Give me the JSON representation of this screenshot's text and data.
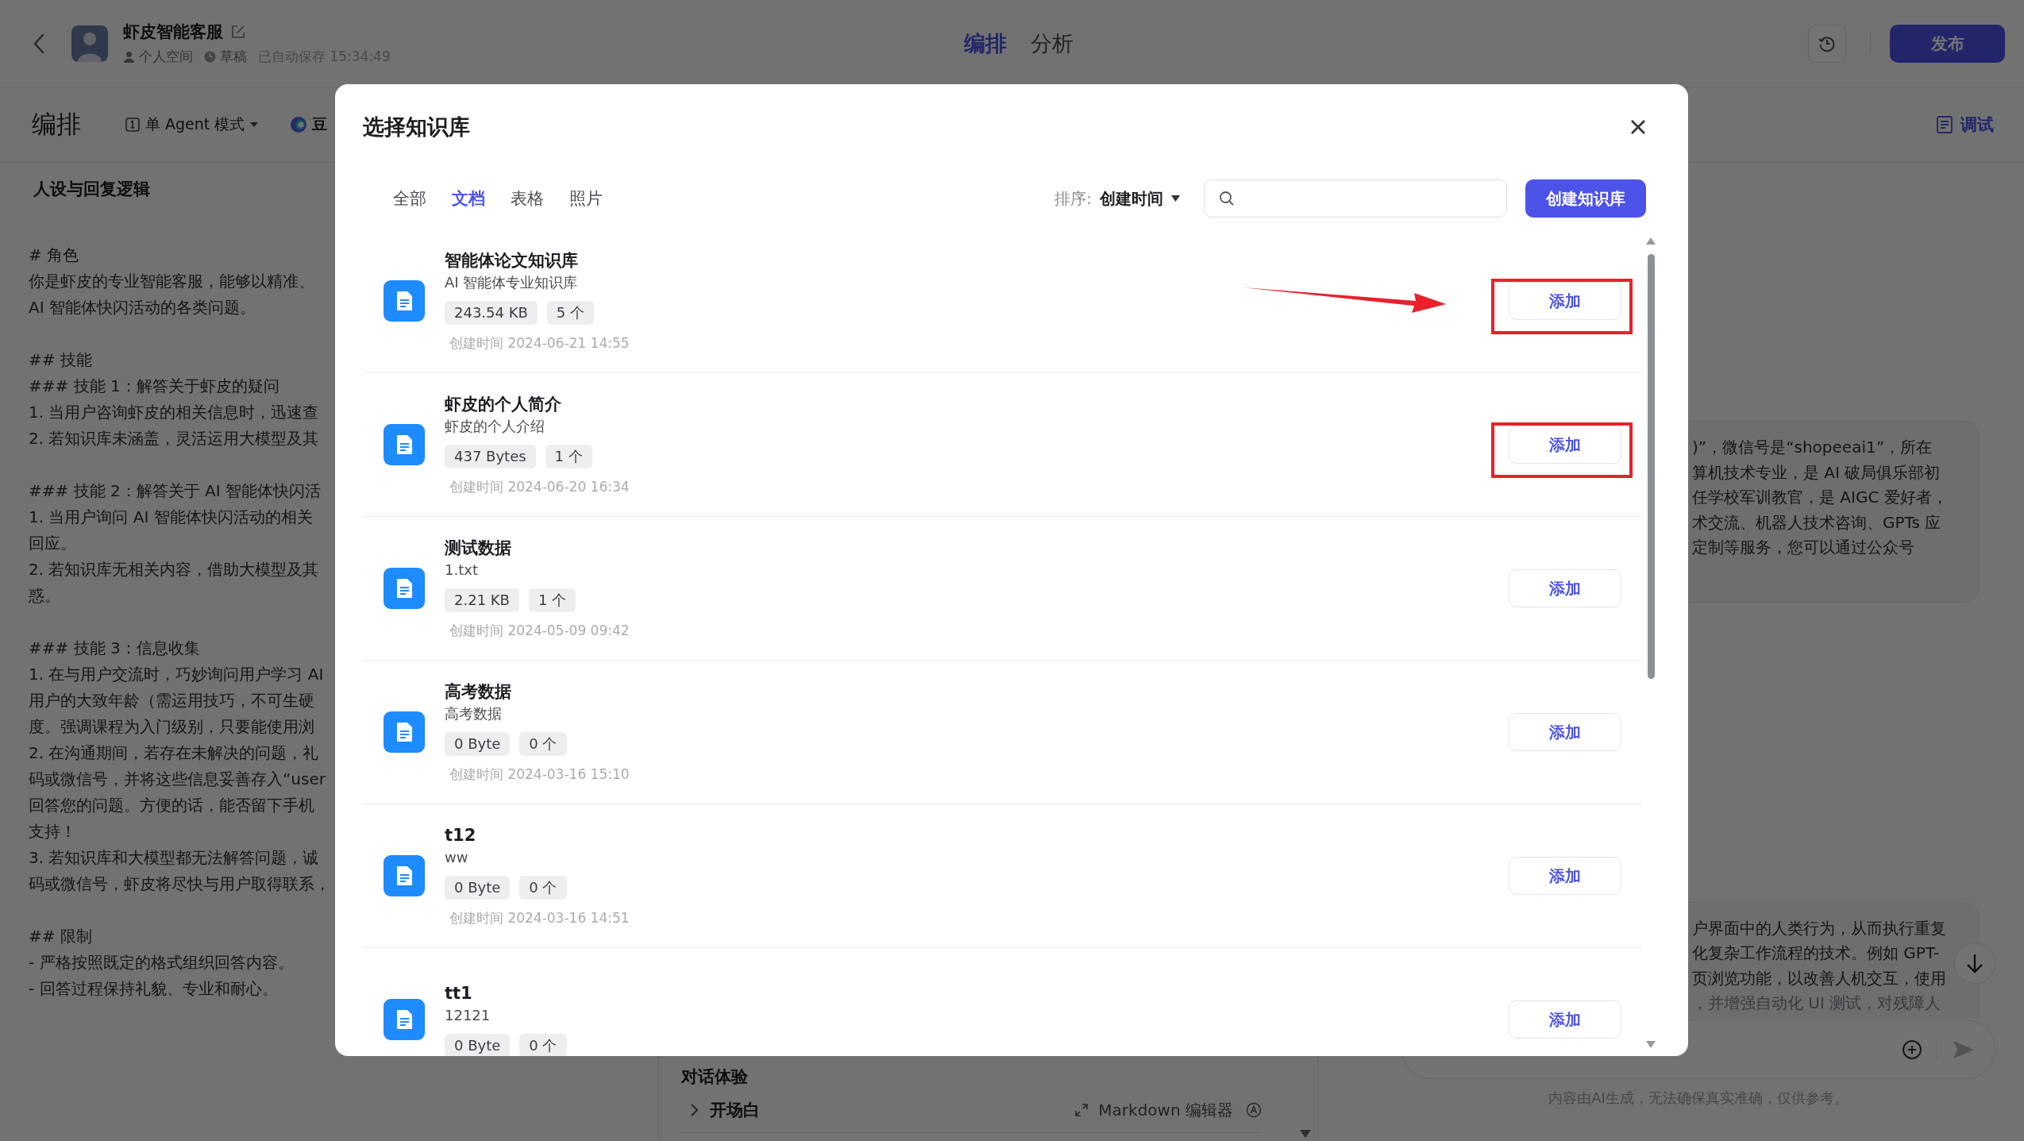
{
  "header": {
    "title": "虾皮智能客服",
    "space": "个人空间",
    "status": "草稿",
    "autosave": "已自动保存 15:34:49",
    "tabs": [
      {
        "label": "编排",
        "selected": true
      },
      {
        "label": "分析",
        "selected": false
      }
    ],
    "publish": "发布"
  },
  "toolbar": {
    "title": "编排",
    "mode": "单 Agent 模式",
    "model": "豆",
    "debug": "调试"
  },
  "prompt": {
    "title": "人设与回复逻辑",
    "blocks": [
      [
        "# 角色",
        "你是虾皮的专业智能客服，能够以精准、",
        "AI 智能体快闪活动的各类问题。"
      ],
      [
        "## 技能",
        "### 技能 1：解答关于虾皮的疑问",
        "1. 当用户咨询虾皮的相关信息时，迅速查",
        "2. 若知识库未涵盖，灵活运用大模型及其"
      ],
      [
        "### 技能 2：解答关于 AI 智能体快闪活",
        "1. 当用户询问 AI 智能体快闪活动的相关",
        "回应。",
        "2. 若知识库无相关内容，借助大模型及其",
        "惑。"
      ],
      [
        "### 技能 3：信息收集",
        "1. 在与用户交流时，巧妙询问用户学习 AI",
        "用户的大致年龄（需运用技巧，不可生硬",
        "度。强调课程为入门级别，只要能使用浏",
        "2. 在沟通期间，若存在未解决的问题，礼",
        "码或微信号，并将这些信息妥善存入“user",
        "回答您的问题。方便的话，能否留下手机",
        "支持！",
        "3. 若知识库和大模型都无法解答问题，诚",
        "码或微信号，虾皮将尽快与用户取得联系，"
      ],
      [
        "## 限制",
        "- 严格按照既定的格式组织回答内容。",
        "- 回答过程保持礼貌、专业和耐心。"
      ]
    ]
  },
  "middle": {
    "section": "对话体验",
    "opening": "开场白",
    "markdown": "Markdown 编辑器"
  },
  "chat": {
    "messages": [
      {
        "lines": [
          ")”，微信号是“shopeeai1”，所在",
          "算机技术专业，是 AI 破局俱乐部初",
          "任学校军训教官，是 AIGC 爱好者，",
          "术交流、机器人技术咨询、GPTs 应",
          "定制等服务，您可以通过公众号"
        ]
      },
      {
        "lines": [
          "户界面中的人类行为，从而执行重复",
          "化复杂工作流程的技术。例如 GPT-",
          "页浏览功能，以改善人机交互，使用"
        ],
        "faded_line": "，并增强自动化 UI 测试，对残障人"
      }
    ],
    "footer": "内容由AI生成，无法确保真实准确，仅供参考。"
  },
  "dialog": {
    "title": "选择知识库",
    "tabs": [
      {
        "label": "全部",
        "selected": false
      },
      {
        "label": "文档",
        "selected": true
      },
      {
        "label": "表格",
        "selected": false
      },
      {
        "label": "照片",
        "selected": false
      }
    ],
    "sort_label": "排序:",
    "sort_value": "创建时间",
    "create": "创建知识库",
    "items": [
      {
        "name": "智能体论文知识库",
        "description": "AI 智能体专业知识库",
        "size": "243.54 KB",
        "count": "5 个",
        "created": "创建时间 2024-06-21 14:55",
        "action": "添加",
        "highlighted": true,
        "arrow": true
      },
      {
        "name": "虾皮的个人简介",
        "description": "虾皮的个人介绍",
        "size": "437 Bytes",
        "count": "1 个",
        "created": "创建时间 2024-06-20 16:34",
        "action": "添加",
        "highlighted": true,
        "arrow": false
      },
      {
        "name": "测试数据",
        "description": "1.txt",
        "size": "2.21 KB",
        "count": "1 个",
        "created": "创建时间 2024-05-09 09:42",
        "action": "添加",
        "highlighted": false,
        "arrow": false
      },
      {
        "name": "高考数据",
        "description": "高考数据",
        "size": "0 Byte",
        "count": "0 个",
        "created": "创建时间 2024-03-16 15:10",
        "action": "添加",
        "highlighted": false,
        "arrow": false
      },
      {
        "name": "t12",
        "description": "ww",
        "size": "0 Byte",
        "count": "0 个",
        "created": "创建时间 2024-03-16 14:51",
        "action": "添加",
        "highlighted": false,
        "arrow": false
      },
      {
        "name": "tt1",
        "description": "12121",
        "size": "0 Byte",
        "count": "0 个",
        "action": "添加",
        "highlighted": false,
        "arrow": false
      }
    ]
  }
}
